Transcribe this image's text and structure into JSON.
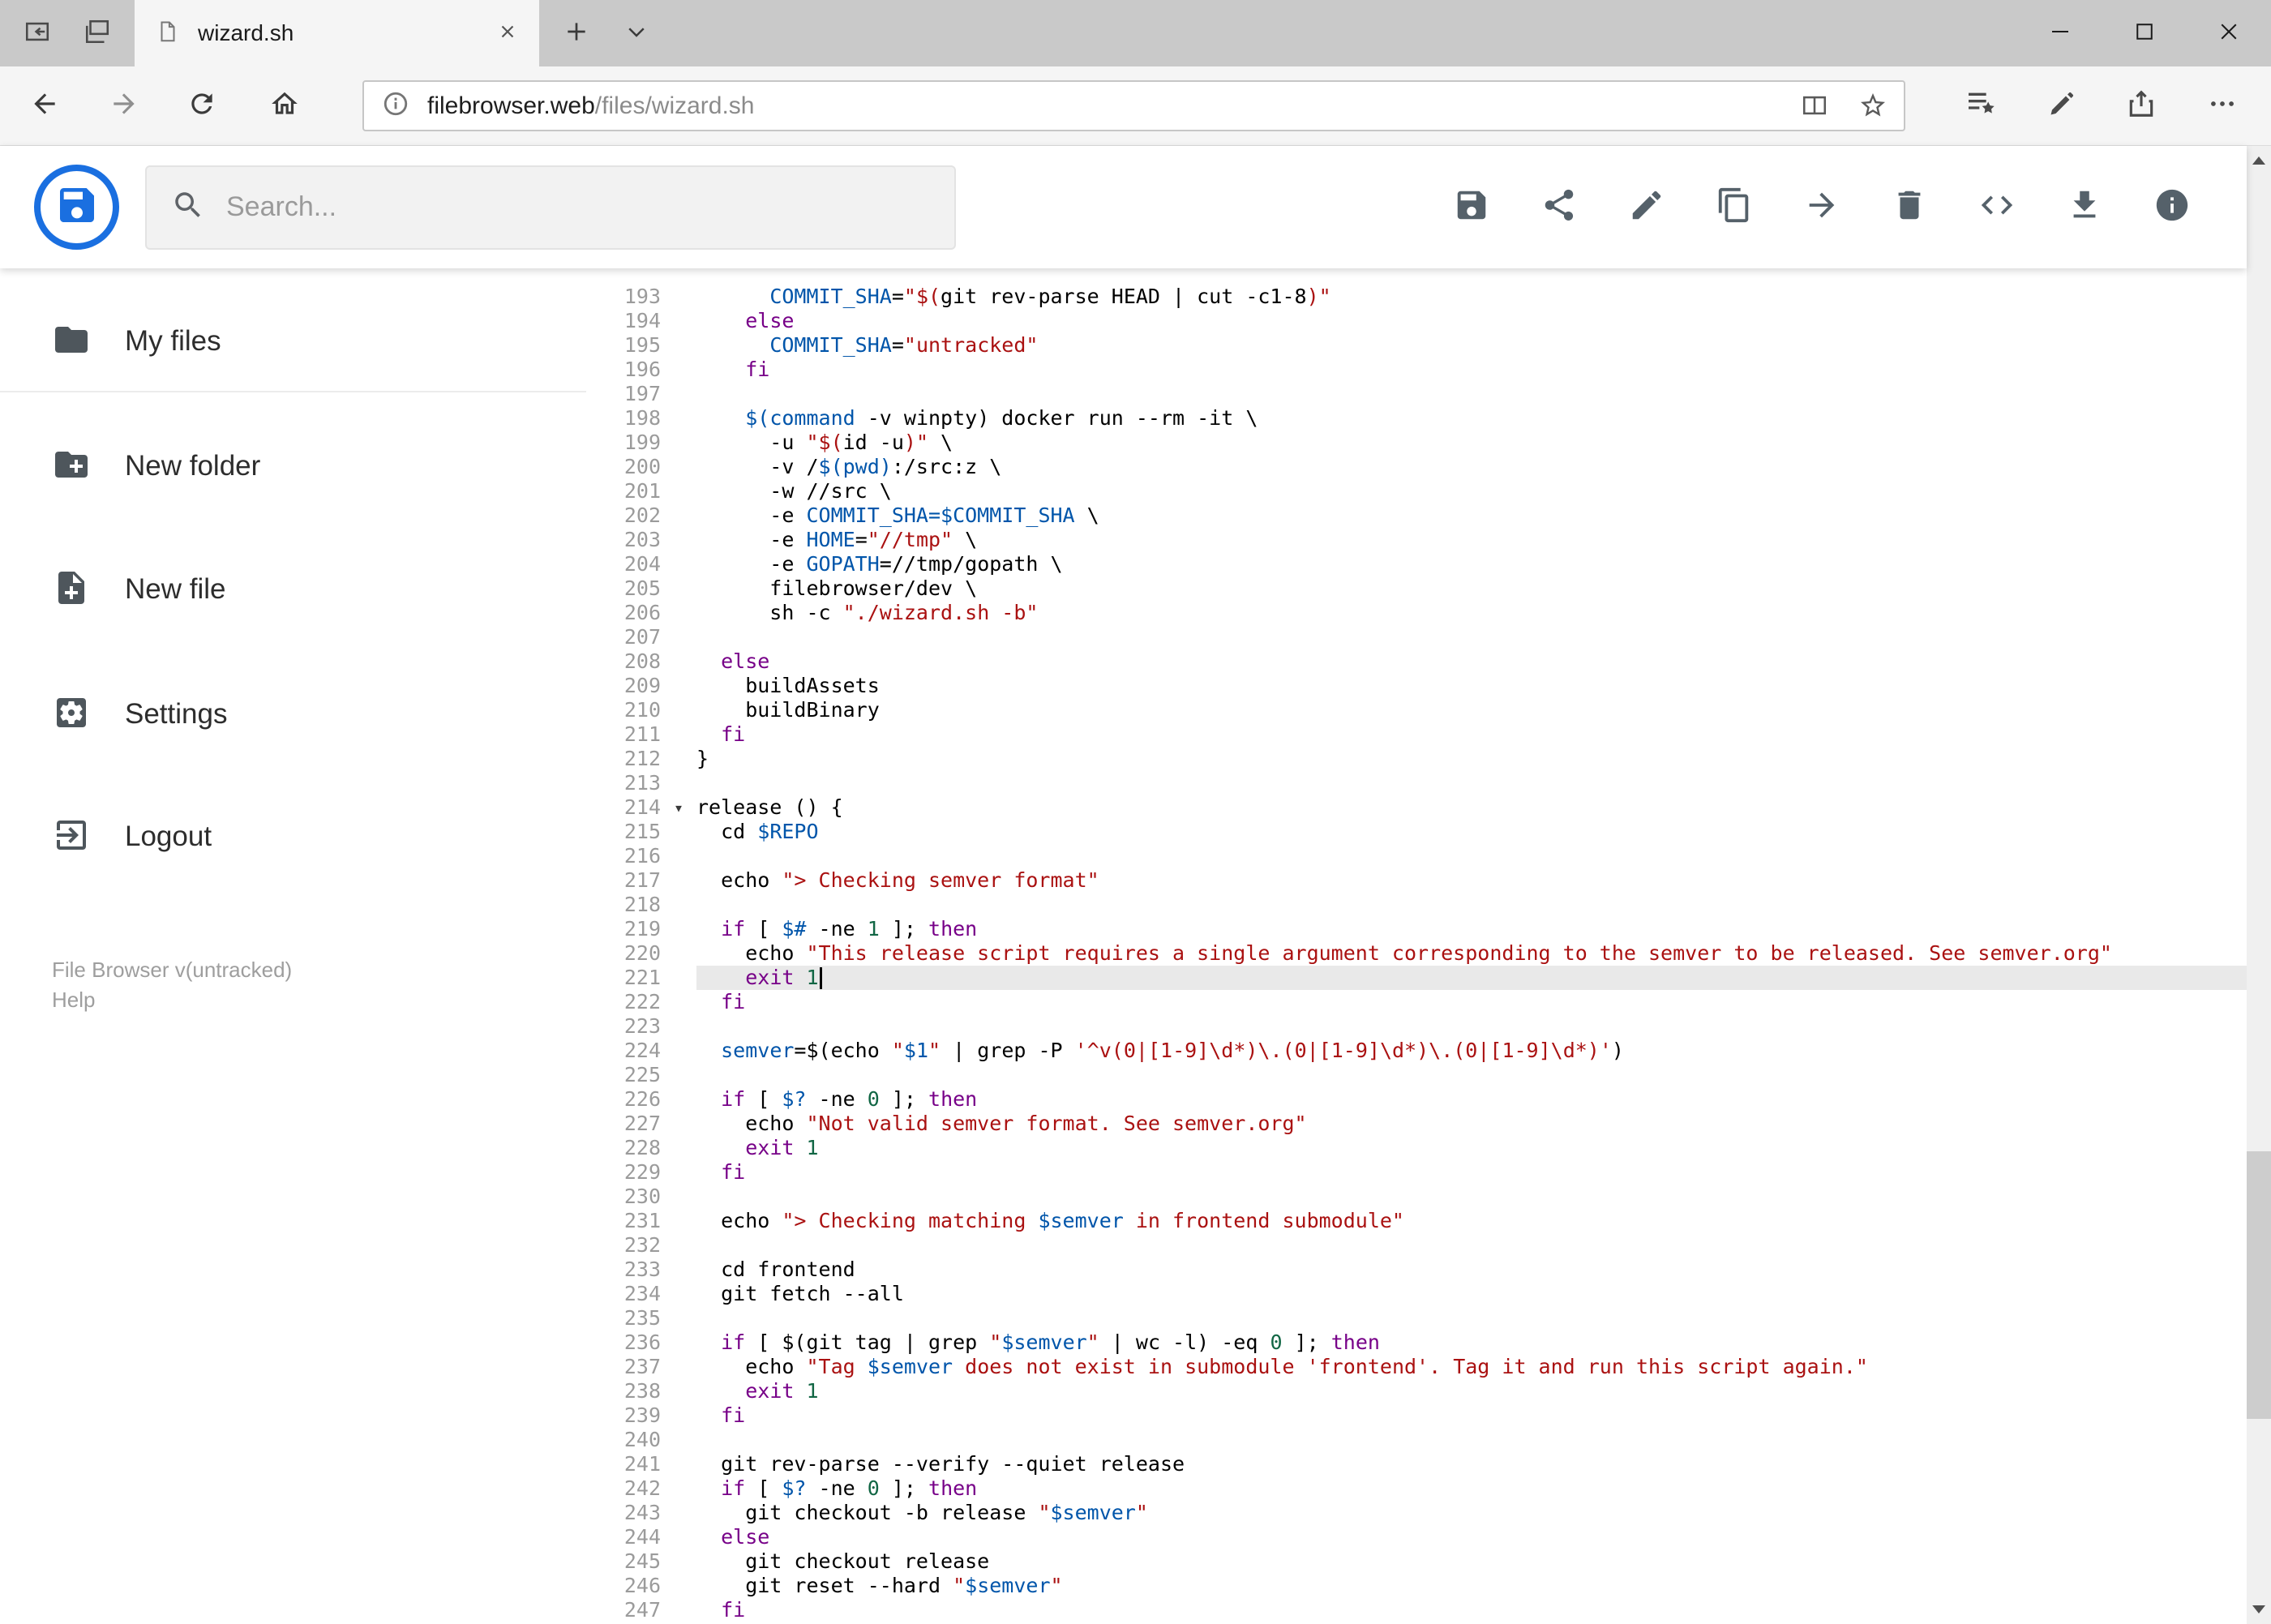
{
  "browser": {
    "tab_title": "wizard.sh",
    "url_host": "filebrowser.web",
    "url_path": "/files/wizard.sh"
  },
  "header": {
    "search_placeholder": "Search...",
    "toolbar": [
      {
        "name": "save-button",
        "icon": "save"
      },
      {
        "name": "share-button",
        "icon": "share"
      },
      {
        "name": "rename-button",
        "icon": "edit"
      },
      {
        "name": "copy-button",
        "icon": "copy"
      },
      {
        "name": "move-button",
        "icon": "move"
      },
      {
        "name": "delete-button",
        "icon": "delete"
      },
      {
        "name": "code-view-button",
        "icon": "code"
      },
      {
        "name": "download-button",
        "icon": "download"
      },
      {
        "name": "info-button",
        "icon": "info"
      }
    ]
  },
  "sidebar": {
    "items": [
      {
        "name": "my-files",
        "icon": "folder",
        "label": "My files"
      },
      {
        "name": "new-folder",
        "icon": "new-folder",
        "label": "New folder"
      },
      {
        "name": "new-file",
        "icon": "new-file",
        "label": "New file"
      },
      {
        "name": "settings",
        "icon": "settings",
        "label": "Settings"
      },
      {
        "name": "logout",
        "icon": "logout",
        "label": "Logout"
      }
    ],
    "footer_version": "File Browser v(untracked)",
    "footer_help": "Help"
  },
  "editor": {
    "active_line": 221,
    "cursor_line": 221,
    "fold_marker_lines": [
      214
    ],
    "active_line_bg": "#e9e9e9",
    "syntax_colors": {
      "plain": "#000000",
      "keyword": "#770088",
      "string": "#aa1111",
      "variable": "#0055aa",
      "number": "#116644"
    },
    "lines": [
      {
        "n": 193,
        "seg": [
          [
            "p",
            "      "
          ],
          [
            "v",
            "COMMIT_SHA"
          ],
          [
            "p",
            "="
          ],
          [
            "s",
            "\"$("
          ],
          [
            "p",
            "git rev-parse HEAD | cut -c1-8"
          ],
          [
            "s",
            ")\""
          ]
        ]
      },
      {
        "n": 194,
        "seg": [
          [
            "p",
            "    "
          ],
          [
            "k",
            "else"
          ]
        ]
      },
      {
        "n": 195,
        "seg": [
          [
            "p",
            "      "
          ],
          [
            "v",
            "COMMIT_SHA"
          ],
          [
            "p",
            "="
          ],
          [
            "s",
            "\"untracked\""
          ]
        ]
      },
      {
        "n": 196,
        "seg": [
          [
            "p",
            "    "
          ],
          [
            "k",
            "fi"
          ]
        ]
      },
      {
        "n": 197,
        "seg": []
      },
      {
        "n": 198,
        "seg": [
          [
            "p",
            "    "
          ],
          [
            "v",
            "$(command"
          ],
          [
            "p",
            " -v winpty) docker run --rm -it \\"
          ]
        ]
      },
      {
        "n": 199,
        "seg": [
          [
            "p",
            "      -u "
          ],
          [
            "s",
            "\"$("
          ],
          [
            "p",
            "id -u"
          ],
          [
            "s",
            ")\""
          ],
          [
            "p",
            " \\"
          ]
        ]
      },
      {
        "n": 200,
        "seg": [
          [
            "p",
            "      -v /"
          ],
          [
            "v",
            "$(pwd)"
          ],
          [
            "p",
            ":/src:z \\"
          ]
        ]
      },
      {
        "n": 201,
        "seg": [
          [
            "p",
            "      -w //src \\"
          ]
        ]
      },
      {
        "n": 202,
        "seg": [
          [
            "p",
            "      -e "
          ],
          [
            "v",
            "COMMIT_SHA=$COMMIT_SHA"
          ],
          [
            "p",
            " \\"
          ]
        ]
      },
      {
        "n": 203,
        "seg": [
          [
            "p",
            "      -e "
          ],
          [
            "v",
            "HOME"
          ],
          [
            "p",
            "="
          ],
          [
            "s",
            "\"//tmp\""
          ],
          [
            "p",
            " \\"
          ]
        ]
      },
      {
        "n": 204,
        "seg": [
          [
            "p",
            "      -e "
          ],
          [
            "v",
            "GOPATH"
          ],
          [
            "p",
            "=//tmp/gopath \\"
          ]
        ]
      },
      {
        "n": 205,
        "seg": [
          [
            "p",
            "      filebrowser/dev \\"
          ]
        ]
      },
      {
        "n": 206,
        "seg": [
          [
            "p",
            "      sh -c "
          ],
          [
            "s",
            "\"./wizard.sh -b\""
          ]
        ]
      },
      {
        "n": 207,
        "seg": []
      },
      {
        "n": 208,
        "seg": [
          [
            "p",
            "  "
          ],
          [
            "k",
            "else"
          ]
        ]
      },
      {
        "n": 209,
        "seg": [
          [
            "p",
            "    buildAssets"
          ]
        ]
      },
      {
        "n": 210,
        "seg": [
          [
            "p",
            "    buildBinary"
          ]
        ]
      },
      {
        "n": 211,
        "seg": [
          [
            "p",
            "  "
          ],
          [
            "k",
            "fi"
          ]
        ]
      },
      {
        "n": 212,
        "seg": [
          [
            "p",
            "}"
          ]
        ]
      },
      {
        "n": 213,
        "seg": []
      },
      {
        "n": 214,
        "seg": [
          [
            "p",
            "release () {"
          ]
        ]
      },
      {
        "n": 215,
        "seg": [
          [
            "p",
            "  cd "
          ],
          [
            "v",
            "$REPO"
          ]
        ]
      },
      {
        "n": 216,
        "seg": []
      },
      {
        "n": 217,
        "seg": [
          [
            "p",
            "  echo "
          ],
          [
            "s",
            "\"> Checking semver format\""
          ]
        ]
      },
      {
        "n": 218,
        "seg": []
      },
      {
        "n": 219,
        "seg": [
          [
            "p",
            "  "
          ],
          [
            "k",
            "if"
          ],
          [
            "p",
            " [ "
          ],
          [
            "v",
            "$#"
          ],
          [
            "p",
            " -ne "
          ],
          [
            "n",
            "1"
          ],
          [
            "p",
            " ]; "
          ],
          [
            "k",
            "then"
          ]
        ]
      },
      {
        "n": 220,
        "seg": [
          [
            "p",
            "    echo "
          ],
          [
            "s",
            "\"This release script requires a single argument corresponding to the semver to be released. See semver.org\""
          ]
        ]
      },
      {
        "n": 221,
        "seg": [
          [
            "p",
            "    "
          ],
          [
            "k",
            "exit"
          ],
          [
            "p",
            " "
          ],
          [
            "n",
            "1"
          ]
        ]
      },
      {
        "n": 222,
        "seg": [
          [
            "p",
            "  "
          ],
          [
            "k",
            "fi"
          ]
        ]
      },
      {
        "n": 223,
        "seg": []
      },
      {
        "n": 224,
        "seg": [
          [
            "p",
            "  "
          ],
          [
            "v",
            "semver"
          ],
          [
            "p",
            "=$(echo "
          ],
          [
            "s",
            "\""
          ],
          [
            "v",
            "$1"
          ],
          [
            "s",
            "\""
          ],
          [
            "p",
            " | grep -P "
          ],
          [
            "s",
            "'^v(0|[1-9]\\d*)\\.(0|[1-9]\\d*)\\.(0|[1-9]\\d*)'"
          ],
          [
            "p",
            ")"
          ]
        ]
      },
      {
        "n": 225,
        "seg": []
      },
      {
        "n": 226,
        "seg": [
          [
            "p",
            "  "
          ],
          [
            "k",
            "if"
          ],
          [
            "p",
            " [ "
          ],
          [
            "v",
            "$?"
          ],
          [
            "p",
            " -ne "
          ],
          [
            "n",
            "0"
          ],
          [
            "p",
            " ]; "
          ],
          [
            "k",
            "then"
          ]
        ]
      },
      {
        "n": 227,
        "seg": [
          [
            "p",
            "    echo "
          ],
          [
            "s",
            "\"Not valid semver format. See semver.org\""
          ]
        ]
      },
      {
        "n": 228,
        "seg": [
          [
            "p",
            "    "
          ],
          [
            "k",
            "exit"
          ],
          [
            "p",
            " "
          ],
          [
            "n",
            "1"
          ]
        ]
      },
      {
        "n": 229,
        "seg": [
          [
            "p",
            "  "
          ],
          [
            "k",
            "fi"
          ]
        ]
      },
      {
        "n": 230,
        "seg": []
      },
      {
        "n": 231,
        "seg": [
          [
            "p",
            "  echo "
          ],
          [
            "s",
            "\"> Checking matching "
          ],
          [
            "v",
            "$semver"
          ],
          [
            "s",
            " in frontend submodule\""
          ]
        ]
      },
      {
        "n": 232,
        "seg": []
      },
      {
        "n": 233,
        "seg": [
          [
            "p",
            "  cd frontend"
          ]
        ]
      },
      {
        "n": 234,
        "seg": [
          [
            "p",
            "  git fetch --all"
          ]
        ]
      },
      {
        "n": 235,
        "seg": []
      },
      {
        "n": 236,
        "seg": [
          [
            "p",
            "  "
          ],
          [
            "k",
            "if"
          ],
          [
            "p",
            " [ $(git tag | grep "
          ],
          [
            "s",
            "\""
          ],
          [
            "v",
            "$semver"
          ],
          [
            "s",
            "\""
          ],
          [
            "p",
            " | wc -l) -eq "
          ],
          [
            "n",
            "0"
          ],
          [
            "p",
            " ]; "
          ],
          [
            "k",
            "then"
          ]
        ]
      },
      {
        "n": 237,
        "seg": [
          [
            "p",
            "    echo "
          ],
          [
            "s",
            "\"Tag "
          ],
          [
            "v",
            "$semver"
          ],
          [
            "s",
            " does not exist in submodule 'frontend'. Tag it and run this script again.\""
          ]
        ]
      },
      {
        "n": 238,
        "seg": [
          [
            "p",
            "    "
          ],
          [
            "k",
            "exit"
          ],
          [
            "p",
            " "
          ],
          [
            "n",
            "1"
          ]
        ]
      },
      {
        "n": 239,
        "seg": [
          [
            "p",
            "  "
          ],
          [
            "k",
            "fi"
          ]
        ]
      },
      {
        "n": 240,
        "seg": []
      },
      {
        "n": 241,
        "seg": [
          [
            "p",
            "  git rev-parse --verify --quiet release"
          ]
        ]
      },
      {
        "n": 242,
        "seg": [
          [
            "p",
            "  "
          ],
          [
            "k",
            "if"
          ],
          [
            "p",
            " [ "
          ],
          [
            "v",
            "$?"
          ],
          [
            "p",
            " -ne "
          ],
          [
            "n",
            "0"
          ],
          [
            "p",
            " ]; "
          ],
          [
            "k",
            "then"
          ]
        ]
      },
      {
        "n": 243,
        "seg": [
          [
            "p",
            "    git checkout -b release "
          ],
          [
            "s",
            "\""
          ],
          [
            "v",
            "$semver"
          ],
          [
            "s",
            "\""
          ]
        ]
      },
      {
        "n": 244,
        "seg": [
          [
            "p",
            "  "
          ],
          [
            "k",
            "else"
          ]
        ]
      },
      {
        "n": 245,
        "seg": [
          [
            "p",
            "    git checkout release"
          ]
        ]
      },
      {
        "n": 246,
        "seg": [
          [
            "p",
            "    git reset --hard "
          ],
          [
            "s",
            "\""
          ],
          [
            "v",
            "$semver"
          ],
          [
            "s",
            "\""
          ]
        ]
      },
      {
        "n": 247,
        "seg": [
          [
            "p",
            "  "
          ],
          [
            "k",
            "fi"
          ]
        ]
      }
    ]
  }
}
